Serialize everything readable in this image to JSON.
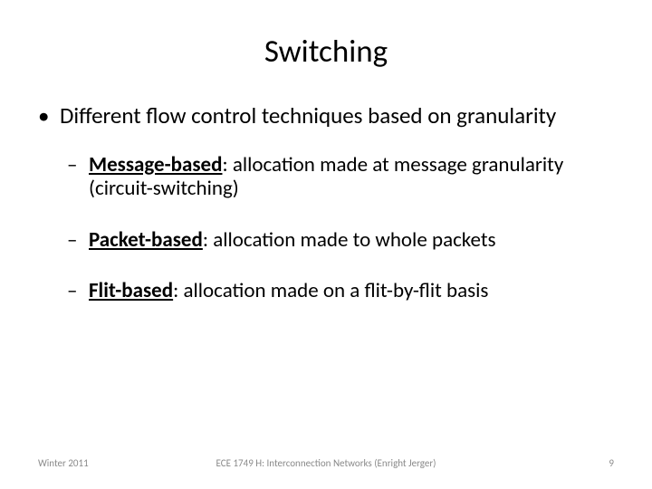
{
  "title": "Switching",
  "bullets": {
    "main": "Different flow control techniques based on granularity",
    "items": [
      {
        "term": "Message-based",
        "rest": ": allocation made at message granularity (circuit-switching)"
      },
      {
        "term": "Packet-based",
        "rest": ": allocation made to whole packets"
      },
      {
        "term": "Flit-based",
        "rest": ": allocation made on a flit-by-flit basis"
      }
    ]
  },
  "footer": {
    "left": "Winter 2011",
    "center": "ECE 1749 H: Interconnection Networks (Enright Jerger)",
    "right": "9"
  }
}
